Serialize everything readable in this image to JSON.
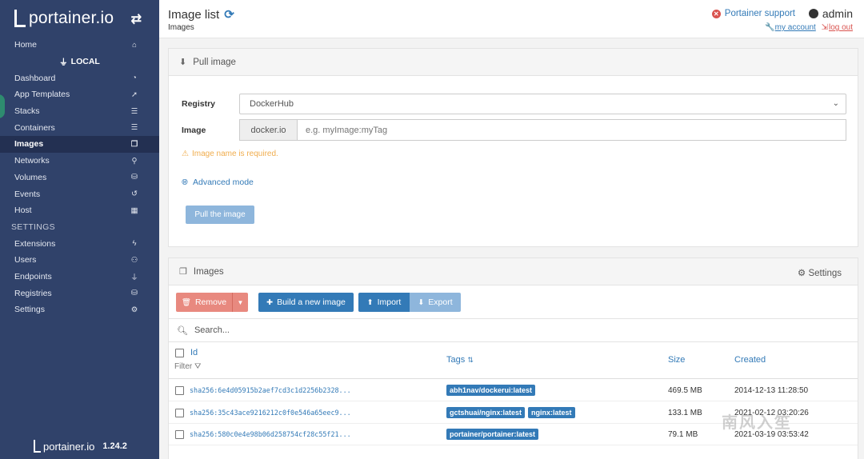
{
  "sidebar": {
    "brand": "portainer.io",
    "items_top": [
      {
        "label": "Home",
        "icon": "home-icon",
        "glyph": "⌂"
      }
    ],
    "endpoint": "LOCAL",
    "items": [
      {
        "label": "Dashboard",
        "icon": "dashboard-icon",
        "glyph": "◔"
      },
      {
        "label": "App Templates",
        "icon": "rocket-icon",
        "glyph": "➚"
      },
      {
        "label": "Stacks",
        "icon": "stacks-icon",
        "glyph": "☰"
      },
      {
        "label": "Containers",
        "icon": "containers-icon",
        "glyph": "☰"
      },
      {
        "label": "Images",
        "icon": "images-icon",
        "glyph": "❐",
        "active": true
      },
      {
        "label": "Networks",
        "icon": "networks-icon",
        "glyph": "⚲"
      },
      {
        "label": "Volumes",
        "icon": "volumes-icon",
        "glyph": "⛁"
      },
      {
        "label": "Events",
        "icon": "history-icon",
        "glyph": "↺"
      },
      {
        "label": "Host",
        "icon": "host-icon",
        "glyph": "▦"
      }
    ],
    "settings_heading": "SETTINGS",
    "settings_items": [
      {
        "label": "Extensions",
        "icon": "bolt-icon",
        "glyph": "ϟ"
      },
      {
        "label": "Users",
        "icon": "users-icon",
        "glyph": "⚇"
      },
      {
        "label": "Endpoints",
        "icon": "plug-icon",
        "glyph": "⏚"
      },
      {
        "label": "Registries",
        "icon": "database-icon",
        "glyph": "⛁"
      },
      {
        "label": "Settings",
        "icon": "cogs-icon",
        "glyph": "⚙"
      }
    ],
    "footer_brand": "portainer.io",
    "version": "1.24.2"
  },
  "header": {
    "title": "Image list",
    "breadcrumb": "Images",
    "support": "Portainer support",
    "user": "admin",
    "my_account": "my account",
    "log_out": "log out"
  },
  "pull": {
    "title": "Pull image",
    "registry_label": "Registry",
    "registry_value": "DockerHub",
    "image_label": "Image",
    "image_prefix": "docker.io",
    "image_placeholder": "e.g. myImage:myTag",
    "warning": "Image name is required.",
    "advanced": "Advanced mode",
    "pull_button": "Pull the image"
  },
  "images": {
    "title": "Images",
    "settings": "Settings",
    "remove": "Remove",
    "build": "Build a new image",
    "import": "Import",
    "export": "Export",
    "search_placeholder": "Search...",
    "col_id": "Id",
    "filter": "Filter",
    "col_tags": "Tags",
    "col_size": "Size",
    "col_created": "Created",
    "rows": [
      {
        "id": "sha256:6e4d05915b2aef7cd3c1d2256b2328...",
        "tags": [
          "abh1nav/dockerui:latest"
        ],
        "size": "469.5 MB",
        "created": "2014-12-13 11:28:50"
      },
      {
        "id": "sha256:35c43ace9216212c0f0e546a65eec9...",
        "tags": [
          "gctshuai/nginx:latest",
          "nginx:latest"
        ],
        "size": "133.1 MB",
        "created": "2021-02-12 03:20:26"
      },
      {
        "id": "sha256:580c0e4e98b06d258754cf28c55f21...",
        "tags": [
          "portainer/portainer:latest"
        ],
        "size": "79.1 MB",
        "created": "2021-03-19 03:53:42"
      }
    ]
  },
  "watermark": "南风入笙"
}
